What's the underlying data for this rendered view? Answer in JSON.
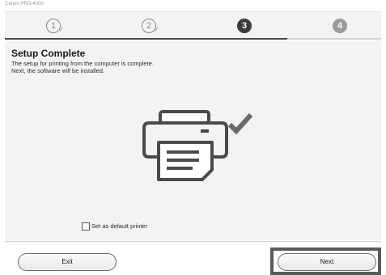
{
  "window": {
    "title": "Canon PRO-4000"
  },
  "steps": [
    {
      "number": "1",
      "state": "done"
    },
    {
      "number": "2",
      "state": "done"
    },
    {
      "number": "3",
      "state": "current"
    },
    {
      "number": "4",
      "state": "future"
    }
  ],
  "progress": {
    "fraction": 0.75
  },
  "main": {
    "heading": "Setup Complete",
    "description": "The setup for printing from the computer is complete.\nNext, the software will be installed.",
    "illustration_icon": "printer-icon",
    "status_icon": "checkmark-icon",
    "default_printer": {
      "label": "Set as default printer",
      "checked": false
    }
  },
  "footer": {
    "exit_label": "Exit",
    "next_label": "Next"
  }
}
